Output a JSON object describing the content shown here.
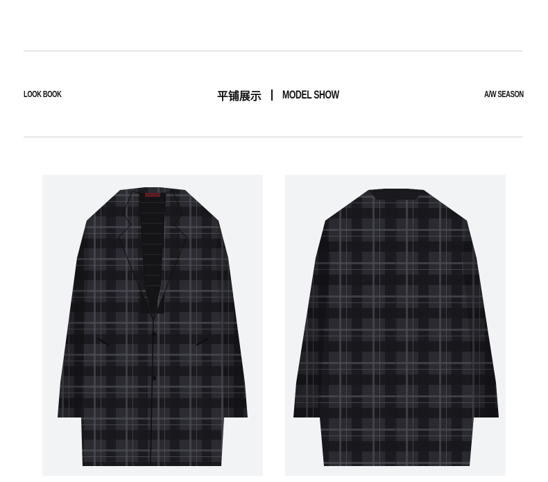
{
  "header": {
    "left_label": "LOOK BOOK",
    "title_cn": "平铺展示",
    "title_en": "MODEL SHOW",
    "right_label": "A/W SEASON"
  },
  "gallery": {
    "items": [
      {
        "view": "front",
        "icon": "coat-front-image"
      },
      {
        "view": "back",
        "icon": "coat-back-image"
      }
    ],
    "colors": {
      "fabric_base": "#2b2b31",
      "plaid_dark": "#16161a",
      "plaid_light": "#4a4a52",
      "background": "#f2f3f5"
    }
  }
}
